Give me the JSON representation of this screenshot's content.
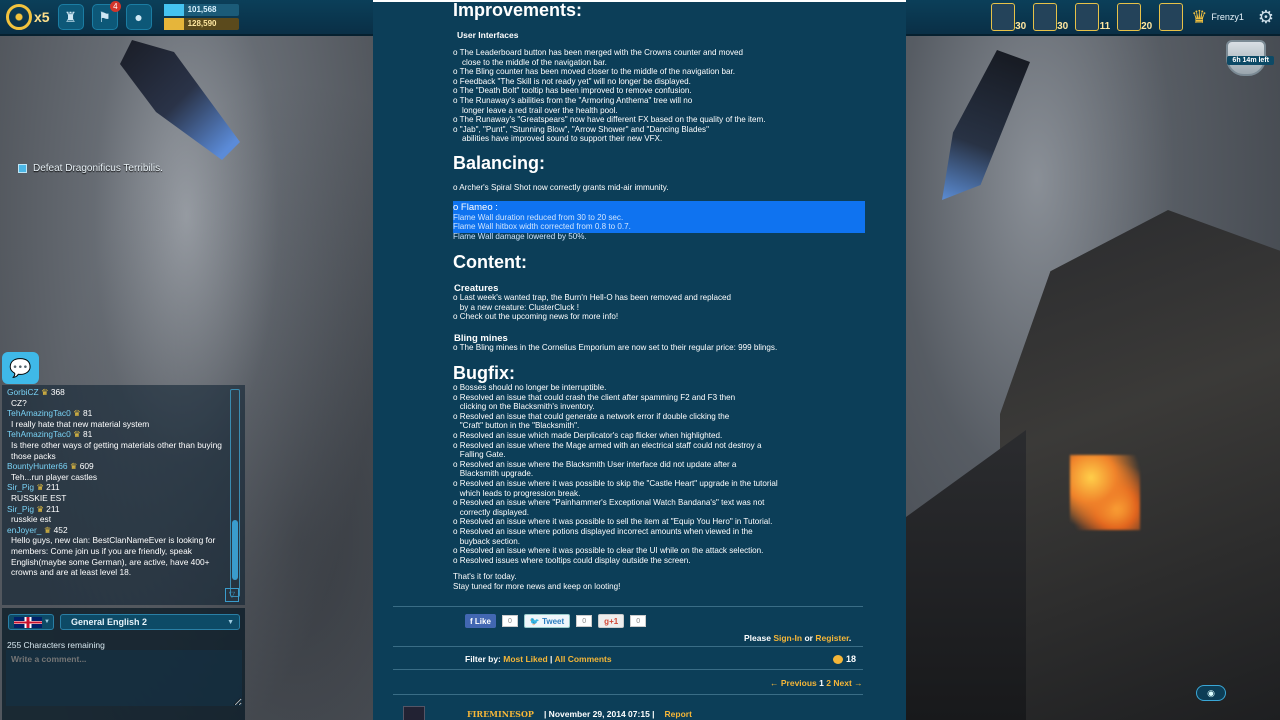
{
  "hud": {
    "lives": "x5",
    "notif_count": "4",
    "resource_blue": "101,568",
    "resource_gold": "128,590",
    "heroes": [
      {
        "level": "30"
      },
      {
        "level": "30"
      },
      {
        "level": "11"
      },
      {
        "level": "20"
      },
      {
        "level": ""
      }
    ],
    "player_name": "Frenzy1",
    "timer": "6h 14m left"
  },
  "quest": {
    "text": "Defeat Dragonificus Terribilis."
  },
  "article": {
    "improvements_heading": "Improvements:",
    "ui_subheading": "User Interfaces",
    "improvements_items": [
      "o The Leaderboard button has been merged with the Crowns counter and moved\n    close to the middle of the navigation bar.",
      "o The Bling counter has been moved closer to the middle of the navigation bar.",
      "o Feedback \"The Skill is not ready yet\" will no longer be displayed.",
      "o The \"Death Bolt\" tooltip has been improved to remove confusion.",
      "o The Runaway's abilities from the \"Armoring Anthema\" tree will no\n    longer leave a red trail over the health pool.",
      "o The Runaway's \"Greatspears\" now have different FX based on the quality of the item.",
      "o \"Jab\", \"Punt\", \"Stunning Blow\", \"Arrow Shower\" and \"Dancing Blades\"\n    abilities have improved sound to support their new VFX."
    ],
    "balancing_heading": "Balancing:",
    "balancing_items": [
      "o Archer's Spiral Shot now correctly grants mid-air immunity."
    ],
    "flameo_title": "o Flameo :",
    "flameo_lines": [
      "  Flame Wall duration reduced from 30 to 20 sec.",
      "  Flame Wall hitbox width corrected from 0.8 to 0.7.",
      "  Flame Wall damage lowered by 50%."
    ],
    "content_heading": "Content:",
    "creatures_sub": "Creatures",
    "creatures_items": [
      "o Last week's wanted trap, the Burn'n Hell-O has been removed and replaced\n   by a new creature: ClusterCluck !",
      "o Check out the upcoming news for more info!"
    ],
    "bling_sub": "Bling mines",
    "bling_items": [
      "o The Bling mines in the Cornelius Emporium are now set to their regular price: 999 blings."
    ],
    "bugfix_heading": "Bugfix:",
    "bugfix_items": [
      "o Bosses should no longer be interruptible.",
      "o Resolved an issue that could crash the client after spamming F2 and F3 then\n   clicking on the Blacksmith's inventory.",
      "o Resolved an issue that could generate a network error if double clicking the\n   \"Craft\" button in the \"Blacksmith\".",
      "o Resolved an issue which made Derplicator's cap flicker when highlighted.",
      "o Resolved an issue where the Mage armed with an electrical staff could not destroy a\n   Falling Gate.",
      "o Resolved an issue where the Blacksmith User interface did not update after a\n   Blacksmith upgrade.",
      "o Resolved an issue where it was possible to skip the \"Castle Heart\" upgrade in the tutorial\n   which leads to progression break.",
      "o Resolved an issue where \"Painhammer's Exceptional Watch Bandana's\" text was not\n   correctly displayed.",
      "o Resolved an issue where it was possible to sell the item at \"Equip You Hero\" in Tutorial.",
      "o Resolved an issue where potions displayed incorrect amounts when viewed in the\n   buyback section.",
      "o Resolved an issue where it was possible to clear the UI while on the attack selection.",
      "o Resolved issues where tooltips could display outside the screen."
    ],
    "outro_1": "That's it for today.",
    "outro_2": "Stay tuned for more news and keep on looting!",
    "share": {
      "like": "Like",
      "like_count": "0",
      "tweet": "Tweet",
      "tweet_count": "0",
      "gplus": "+1",
      "gplus_count": "0"
    },
    "signin_prefix": "Please ",
    "signin_link": "Sign-In",
    "signin_or": " or ",
    "register_link": "Register",
    "signin_suffix": ".",
    "filter_label": "Filter by: ",
    "filter_most_liked": "Most Liked",
    "filter_sep": " | ",
    "filter_all": "All Comments",
    "comment_count": "18",
    "pager_prev": "← Previous",
    "pager_page1": "1",
    "pager_page2": "2",
    "pager_next": "Next →",
    "comment_author": "FIREMINESOP",
    "comment_date": "| November 29, 2014 07:15 |",
    "comment_report": "Report"
  },
  "chat": {
    "messages": [
      {
        "name": "GorbiCZ",
        "crowns": "368",
        "text": "CZ?"
      },
      {
        "name": "TehAmazingTac0",
        "crowns": "81",
        "text": "I really hate that new material system"
      },
      {
        "name": "TehAmazingTac0",
        "crowns": "81",
        "text": "Is there other ways of getting materials other than buying those packs"
      },
      {
        "name": "BountyHunter66",
        "crowns": "609",
        "text": "Teh...run player castles"
      },
      {
        "name": "Sir_Pig",
        "crowns": "211",
        "text": "RUSSKIE EST"
      },
      {
        "name": "Sir_Pig",
        "crowns": "211",
        "text": "russkie est"
      },
      {
        "name": "enJoyer_",
        "crowns": "452",
        "text": "Hello guys, new clan: BestClanNameEver is looking for members: Come join us if you are friendly, speak English(maybe some German), are active, have 400+ crowns and are at least level 18."
      }
    ],
    "channel": "General English 2",
    "chars_remaining": "255 Characters remaining",
    "input_placeholder": "Write a comment..."
  }
}
